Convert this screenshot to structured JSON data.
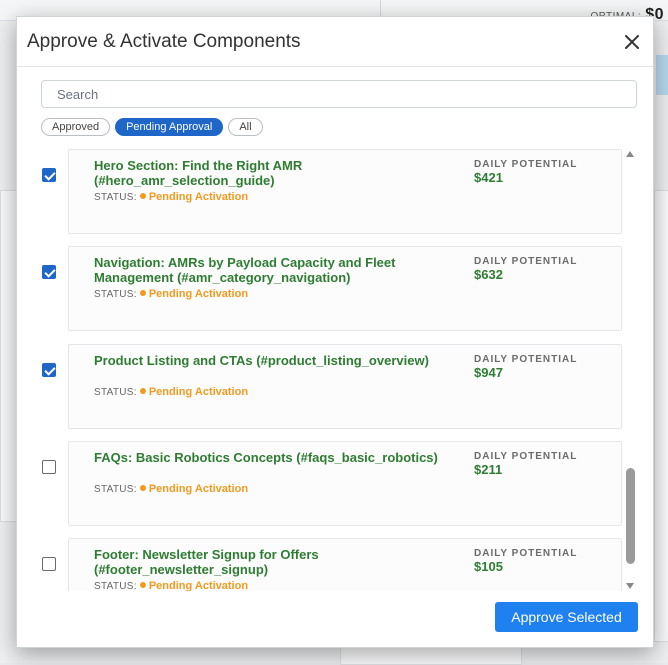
{
  "background": {
    "optimal_label": "OPTIMAL:",
    "optimal_value": "$0"
  },
  "modal": {
    "title": "Approve & Activate Components",
    "search_placeholder": "Search",
    "filters": [
      {
        "label": "Approved",
        "active": false
      },
      {
        "label": "Pending Approval",
        "active": true
      },
      {
        "label": "All",
        "active": false
      }
    ],
    "status_label": "STATUS:",
    "daily_potential_label": "DAILY POTENTIAL",
    "items": [
      {
        "title": "Hero Section: Find the Right AMR (#hero_amr_selection_guide)",
        "status": "Pending Activation",
        "daily_potential": "$421",
        "checked": true
      },
      {
        "title": "Navigation: AMRs by Payload Capacity and Fleet Management (#amr_category_navigation)",
        "status": "Pending Activation",
        "daily_potential": "$632",
        "checked": true
      },
      {
        "title": "Product Listing and CTAs (#product_listing_overview)",
        "status": "Pending Activation",
        "daily_potential": "$947",
        "checked": true
      },
      {
        "title": "FAQs: Basic Robotics Concepts (#faqs_basic_robotics)",
        "status": "Pending Activation",
        "daily_potential": "$211",
        "checked": false
      },
      {
        "title": "Footer: Newsletter Signup for Offers (#footer_newsletter_signup)",
        "status": "Pending Activation",
        "daily_potential": "$105",
        "checked": false
      }
    ],
    "approve_label": "Approve Selected"
  }
}
